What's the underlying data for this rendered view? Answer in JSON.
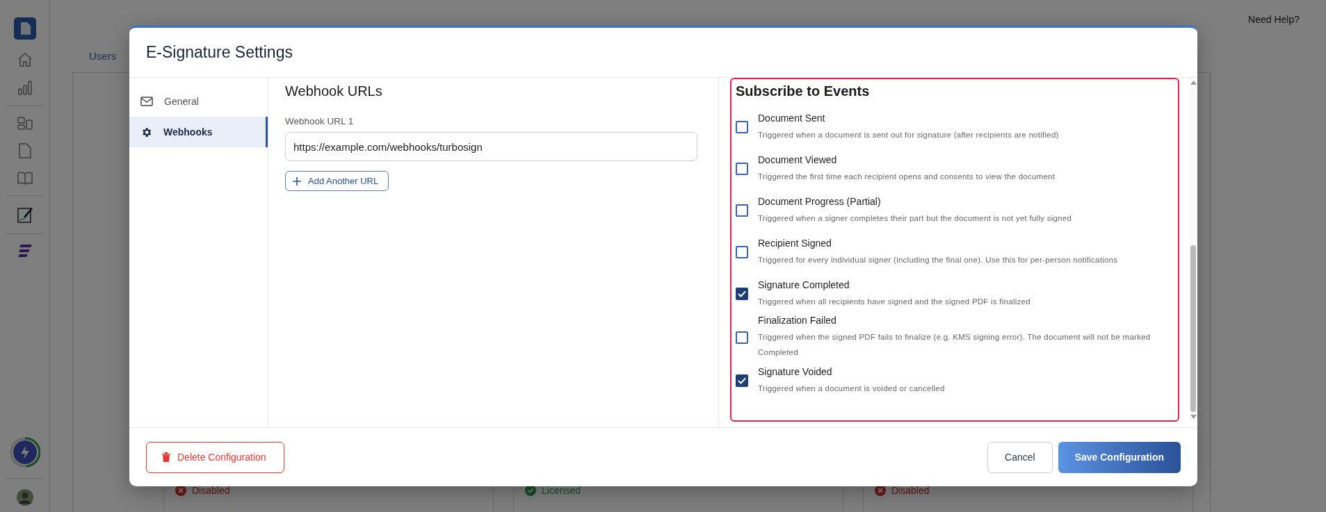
{
  "header": {
    "help_link": "Need Help?"
  },
  "tabs": [
    {
      "label": "Users"
    }
  ],
  "background_cards": [
    {
      "status": "Disabled",
      "kind": "disabled"
    },
    {
      "status": "Licensed",
      "kind": "licensed"
    },
    {
      "status": "Disabled",
      "kind": "disabled"
    }
  ],
  "modal": {
    "title": "E-Signature Settings",
    "nav": [
      {
        "label": "General",
        "kind": "mail",
        "selected": false
      },
      {
        "label": "Webhooks",
        "kind": "gear",
        "selected": true
      }
    ],
    "webhooks": {
      "heading": "Webhook URLs",
      "fields": [
        {
          "label": "Webhook URL 1",
          "value": "https://example.com/webhooks/turbosign"
        }
      ],
      "add_button": "Add Another URL"
    },
    "events": {
      "heading": "Subscribe to Events",
      "items": [
        {
          "name": "Document Sent",
          "description": "Triggered when a document is sent out for signature (after recipients are notified)",
          "checked": false
        },
        {
          "name": "Document Viewed",
          "description": "Triggered the first time each recipient opens and consents to view the document",
          "checked": false
        },
        {
          "name": "Document Progress (Partial)",
          "description": "Triggered when a signer completes their part but the document is not yet fully signed",
          "checked": false
        },
        {
          "name": "Recipient Signed",
          "description": "Triggered for every individual signer (including the final one). Use this for per-person notifications",
          "checked": false
        },
        {
          "name": "Signature Completed",
          "description": "Triggered when all recipients have signed and the signed PDF is finalized",
          "checked": true
        },
        {
          "name": "Finalization Failed",
          "description": "Triggered when the signed PDF fails to finalize (e.g. KMS signing error). The document will not be marked Completed",
          "checked": false
        },
        {
          "name": "Signature Voided",
          "description": "Triggered when a document is voided or cancelled",
          "checked": true
        }
      ]
    },
    "footer": {
      "delete_button": "Delete Configuration",
      "cancel_button": "Cancel",
      "save_button": "Save Configuration"
    }
  }
}
